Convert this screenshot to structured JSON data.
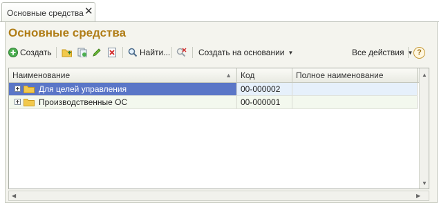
{
  "tab": {
    "title": "Основные средства",
    "close": "✕"
  },
  "form": {
    "title": "Основные средства"
  },
  "toolbar": {
    "create": "Создать",
    "find": "Найти...",
    "create_based_on": "Создать на основании",
    "all_actions": "Все действия",
    "help": "?"
  },
  "table": {
    "columns": [
      "Наименование",
      "Код",
      "Полное наименование"
    ],
    "rows": [
      {
        "name": "Для целей управления",
        "code": "00-000002",
        "full_name": ""
      },
      {
        "name": "Производственные ОС",
        "code": "00-000001",
        "full_name": ""
      }
    ]
  },
  "colors": {
    "title": "#b07d17",
    "selected_row": "#5a76c7",
    "selected_alt": "#e6f0fb",
    "row_alt": "#f3f8ee"
  }
}
